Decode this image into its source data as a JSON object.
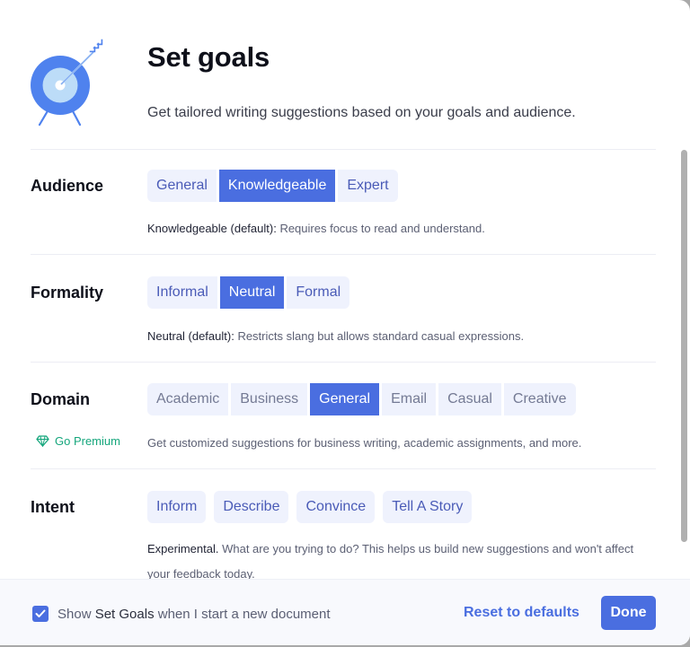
{
  "header": {
    "title": "Set goals",
    "subtitle": "Get tailored writing suggestions based on your goals and audience.",
    "icon": "target-with-arrow-icon"
  },
  "audience": {
    "label": "Audience",
    "options": [
      "General",
      "Knowledgeable",
      "Expert"
    ],
    "selected": "Knowledgeable",
    "description_lead": "Knowledgeable (default):",
    "description": " Requires focus to read and understand."
  },
  "formality": {
    "label": "Formality",
    "options": [
      "Informal",
      "Neutral",
      "Formal"
    ],
    "selected": "Neutral",
    "description_lead": "Neutral (default):",
    "description": " Restricts slang but allows standard casual expressions."
  },
  "domain": {
    "label": "Domain",
    "options": [
      "Academic",
      "Business",
      "General",
      "Email",
      "Casual",
      "Creative"
    ],
    "selected": "General",
    "premium_link": "Go Premium",
    "premium_icon": "diamond-icon",
    "description": "Get customized suggestions for business writing, academic assignments, and more."
  },
  "intent": {
    "label": "Intent",
    "options": [
      "Inform",
      "Describe",
      "Convince",
      "Tell A Story"
    ],
    "description_lead": "Experimental.",
    "description": " What are you trying to do? This helps us build new suggestions and won't affect your feedback today."
  },
  "footer": {
    "checkbox_checked": true,
    "checkbox_prefix": "Show ",
    "checkbox_strong": "Set Goals",
    "checkbox_suffix": " when I start a new document",
    "reset_label": "Reset to defaults",
    "done_label": "Done"
  },
  "colors": {
    "accent": "#4a6ee0",
    "chip_bg": "#eff2fd",
    "chip_text": "#4a5bb7",
    "premium": "#15a67c"
  }
}
